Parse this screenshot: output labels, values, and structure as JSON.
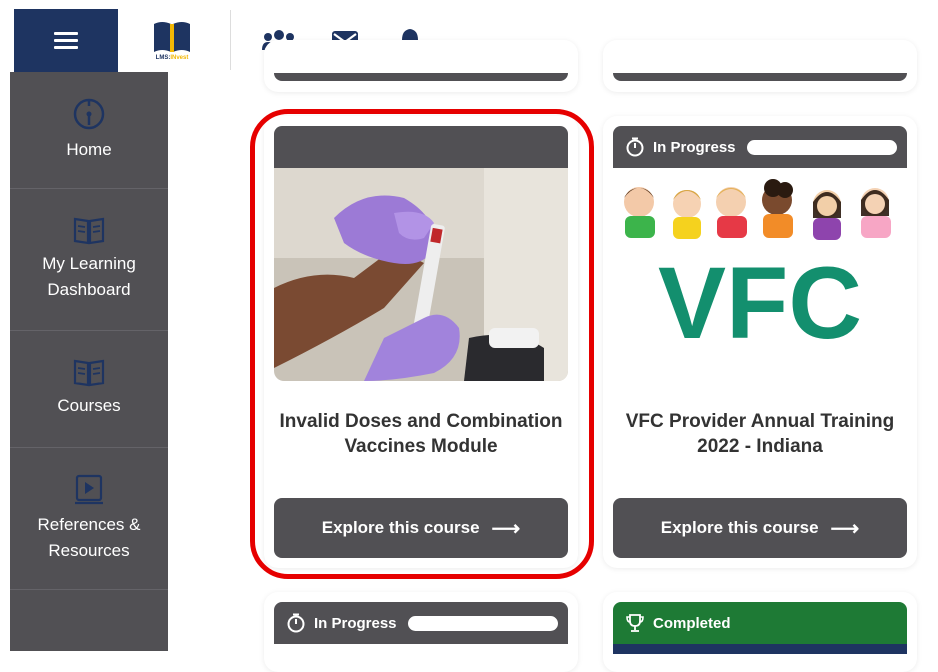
{
  "app": {
    "logo_text": "LMS:",
    "logo_brand": "INvest"
  },
  "sidebar": {
    "items": [
      {
        "label": "Home",
        "icon": "speedometer-icon"
      },
      {
        "label": "My Learning\nDashboard",
        "icon": "open-book-icon"
      },
      {
        "label": "Courses",
        "icon": "open-book-icon"
      },
      {
        "label": "References &\nResources",
        "icon": "video-book-icon"
      }
    ]
  },
  "topbar": {
    "icons": [
      "users-icon",
      "mail-icon",
      "bell-icon"
    ]
  },
  "cards": [
    {
      "title": "Invalid Doses and Combination Vaccines Module",
      "button": "Explore this course",
      "status": "",
      "image": "vaccine-syringe-image"
    },
    {
      "title": "VFC Provider Annual Training 2022 - Indiana",
      "button": "Explore this course",
      "status": "In Progress",
      "progress": 0,
      "image_text": "VFC"
    },
    {
      "status": "In Progress",
      "progress": 0
    },
    {
      "status": "Completed"
    }
  ],
  "colors": {
    "navy": "#1e3461",
    "sidebar": "#515054",
    "highlight": "#e60000",
    "completed": "#1e7a35",
    "vfc_green": "#138f6e"
  }
}
